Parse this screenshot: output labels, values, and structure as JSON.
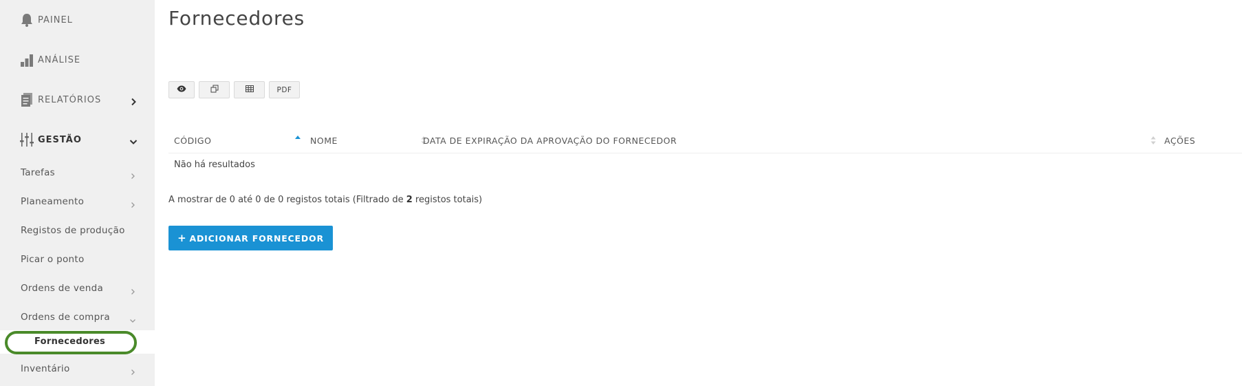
{
  "sidebar": {
    "top_items": [
      {
        "label": "PAINEL",
        "icon": "bell-icon"
      },
      {
        "label": "ANÁLISE",
        "icon": "bar-chart-icon"
      },
      {
        "label": "RELATÓRIOS",
        "icon": "report-icon"
      },
      {
        "label": "GESTÃO",
        "icon": "sliders-icon"
      }
    ],
    "sub_items": [
      {
        "label": "Tarefas"
      },
      {
        "label": "Planeamento"
      },
      {
        "label": "Registos de produção"
      },
      {
        "label": "Picar o ponto"
      },
      {
        "label": "Ordens de venda"
      },
      {
        "label": "Ordens de compra"
      },
      {
        "label": "Fornecedores"
      },
      {
        "label": "Inventário"
      }
    ]
  },
  "main": {
    "title": "Fornecedores",
    "toolbar": {
      "pdf_label": "PDF",
      "icons": [
        "eye-icon",
        "copy-icon",
        "spreadsheet-icon"
      ]
    },
    "table": {
      "columns": [
        "CÓDIGO",
        "NOME",
        "DATA DE EXPIRAÇÃO DA APROVAÇÃO DO FORNECEDOR",
        "AÇÕES"
      ],
      "empty_message": "Não há resultados"
    },
    "info": {
      "prefix": "A mostrar de 0 até 0 de 0 registos totais (Filtrado de ",
      "count": "2",
      "suffix": " registos totais)"
    },
    "add_button": {
      "plus": "+",
      "label": "ADICIONAR FORNECEDOR"
    }
  },
  "colors": {
    "sidebar_bg": "#f0f0f0",
    "primary": "#1a92d4",
    "highlight_ring": "#4a8a2a",
    "sort_active": "#1a92d4"
  }
}
